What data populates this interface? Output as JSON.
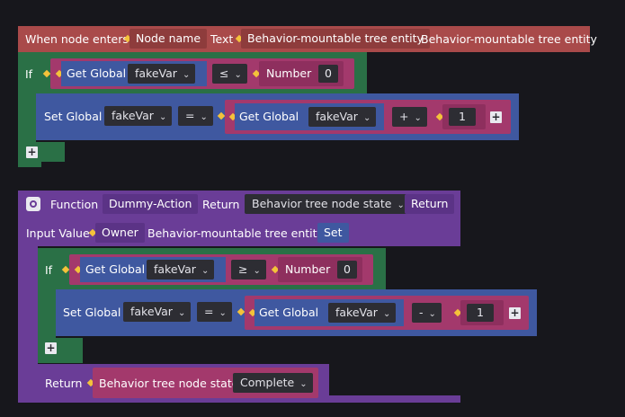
{
  "event_block": {
    "title": "When node enters",
    "param_name_label": "Node name",
    "text_label": "Text",
    "text_value": "Behavior-mountable tree entity",
    "output_value": "Behavior-mountable tree entity"
  },
  "if_block_1": {
    "if_label": "If",
    "get_global_label": "Get Global",
    "var_name": "fakeVar",
    "operator": "≤",
    "number_label": "Number",
    "number_value": "0"
  },
  "set_block_1": {
    "label": "Set Global",
    "var_name": "fakeVar",
    "assign_op": "=",
    "get_global_label": "Get Global",
    "get_var_name": "fakeVar",
    "math_op": "+",
    "value": "1"
  },
  "function_block": {
    "function_label": "Function",
    "function_name": "Dummy-Action",
    "return_label": "Return",
    "return_type": "Behavior tree node state",
    "return_button": "Return",
    "input_value_label": "Input Value",
    "owner_label": "Owner",
    "owner_value": "Behavior-mountable tree entity",
    "set_button": "Set"
  },
  "if_block_2": {
    "if_label": "If",
    "get_global_label": "Get Global",
    "var_name": "fakeVar",
    "operator": "≥",
    "number_label": "Number",
    "number_value": "0"
  },
  "set_block_2": {
    "label": "Set Global",
    "var_name": "fakeVar",
    "assign_op": "=",
    "get_global_label": "Get Global",
    "get_var_name": "fakeVar",
    "math_op": "-",
    "value": "1"
  },
  "return_block": {
    "label": "Return",
    "state_label": "Behavior tree node state",
    "state_value": "Complete"
  },
  "icons": {
    "plus": "+",
    "chevron": "⌄"
  }
}
